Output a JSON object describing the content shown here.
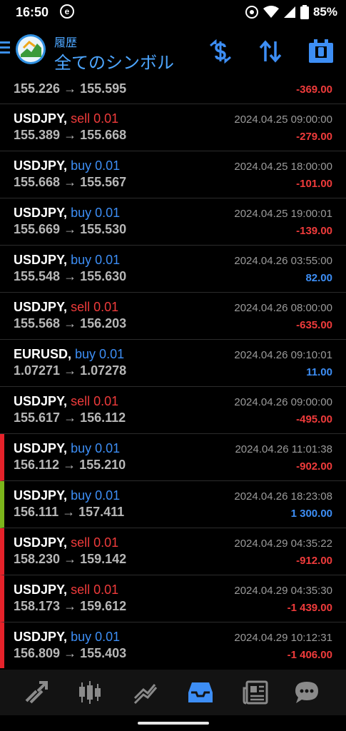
{
  "status_bar": {
    "time": "16:50",
    "e_badge": "e",
    "battery": "85%"
  },
  "header": {
    "subtitle": "履歴",
    "title": "全てのシンボル"
  },
  "rows": [
    {
      "symbol": "",
      "side": "",
      "side_label": "",
      "volume": "",
      "prices": "155.226 → 155.595",
      "datetime": "",
      "profit": "-369.00",
      "profit_sign": "neg",
      "marker": "",
      "first": true
    },
    {
      "symbol": "USDJPY,",
      "side": "sell",
      "side_label": "sell 0.01",
      "prices": "155.389 → 155.668",
      "datetime": "2024.04.25 09:00:00",
      "profit": "-279.00",
      "profit_sign": "neg",
      "marker": ""
    },
    {
      "symbol": "USDJPY,",
      "side": "buy",
      "side_label": "buy 0.01",
      "prices": "155.668 → 155.567",
      "datetime": "2024.04.25 18:00:00",
      "profit": "-101.00",
      "profit_sign": "neg",
      "marker": ""
    },
    {
      "symbol": "USDJPY,",
      "side": "buy",
      "side_label": "buy 0.01",
      "prices": "155.669 → 155.530",
      "datetime": "2024.04.25 19:00:01",
      "profit": "-139.00",
      "profit_sign": "neg",
      "marker": ""
    },
    {
      "symbol": "USDJPY,",
      "side": "buy",
      "side_label": "buy 0.01",
      "prices": "155.548 → 155.630",
      "datetime": "2024.04.26 03:55:00",
      "profit": "82.00",
      "profit_sign": "pos",
      "marker": ""
    },
    {
      "symbol": "USDJPY,",
      "side": "sell",
      "side_label": "sell 0.01",
      "prices": "155.568 → 156.203",
      "datetime": "2024.04.26 08:00:00",
      "profit": "-635.00",
      "profit_sign": "neg",
      "marker": ""
    },
    {
      "symbol": "EURUSD,",
      "side": "buy",
      "side_label": "buy 0.01",
      "prices": "1.07271 → 1.07278",
      "datetime": "2024.04.26 09:10:01",
      "profit": "11.00",
      "profit_sign": "pos",
      "marker": ""
    },
    {
      "symbol": "USDJPY,",
      "side": "sell",
      "side_label": "sell 0.01",
      "prices": "155.617 → 156.112",
      "datetime": "2024.04.26 09:00:00",
      "profit": "-495.00",
      "profit_sign": "neg",
      "marker": ""
    },
    {
      "symbol": "USDJPY,",
      "side": "buy",
      "side_label": "buy 0.01",
      "prices": "156.112 → 155.210",
      "datetime": "2024.04.26 11:01:38",
      "profit": "-902.00",
      "profit_sign": "neg",
      "marker": "sl"
    },
    {
      "symbol": "USDJPY,",
      "side": "buy",
      "side_label": "buy 0.01",
      "prices": "156.111 → 157.411",
      "datetime": "2024.04.26 18:23:08",
      "profit": "1 300.00",
      "profit_sign": "pos",
      "marker": "tp"
    },
    {
      "symbol": "USDJPY,",
      "side": "sell",
      "side_label": "sell 0.01",
      "prices": "158.230 → 159.142",
      "datetime": "2024.04.29 04:35:22",
      "profit": "-912.00",
      "profit_sign": "neg",
      "marker": "sl"
    },
    {
      "symbol": "USDJPY,",
      "side": "sell",
      "side_label": "sell 0.01",
      "prices": "158.173 → 159.612",
      "datetime": "2024.04.29 04:35:30",
      "profit": "-1 439.00",
      "profit_sign": "neg",
      "marker": "sl"
    },
    {
      "symbol": "USDJPY,",
      "side": "buy",
      "side_label": "buy 0.01",
      "prices": "156.809 → 155.403",
      "datetime": "2024.04.29 10:12:31",
      "profit": "-1 406.00",
      "profit_sign": "neg",
      "marker": "sl"
    }
  ],
  "bottom_nav": [
    {
      "name": "quotes-icon"
    },
    {
      "name": "chart-icon"
    },
    {
      "name": "trade-icon"
    },
    {
      "name": "history-icon",
      "active": true
    },
    {
      "name": "news-icon"
    },
    {
      "name": "chat-icon"
    }
  ],
  "colors": {
    "accent": "#3d8ef5",
    "negative": "#ef3b3b",
    "stop_loss_marker": "#e5222a",
    "take_profit_marker": "#7bb51b"
  }
}
